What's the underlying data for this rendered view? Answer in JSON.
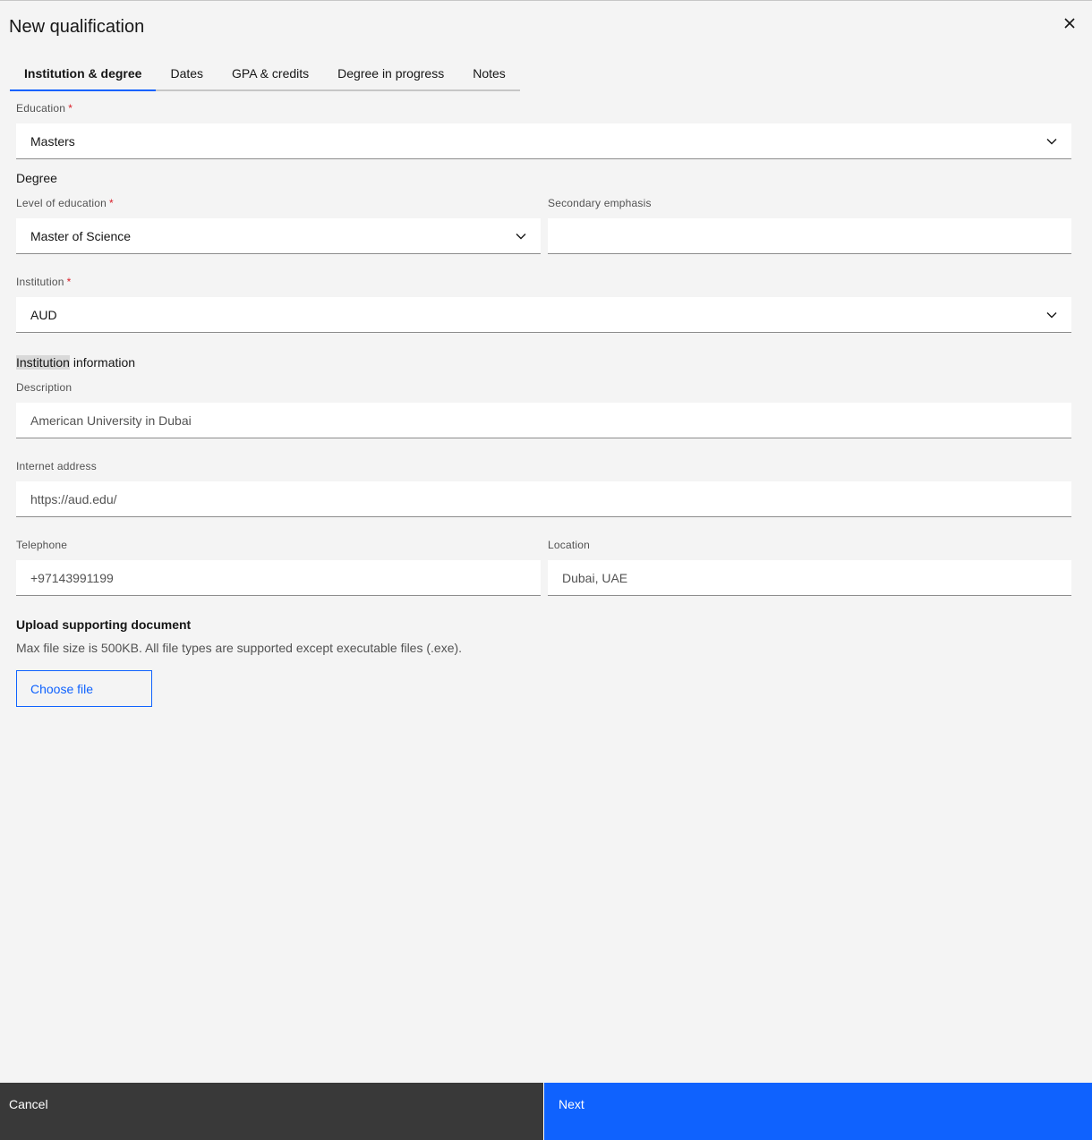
{
  "modal": {
    "title": "New qualification"
  },
  "tabs": [
    {
      "label": "Institution & degree",
      "active": true
    },
    {
      "label": "Dates"
    },
    {
      "label": "GPA & credits"
    },
    {
      "label": "Degree in progress"
    },
    {
      "label": "Notes"
    }
  ],
  "form": {
    "education": {
      "label": "Education",
      "required_mark": "*",
      "value": "Masters"
    },
    "degree_heading": "Degree",
    "level_of_education": {
      "label": "Level of education",
      "required_mark": "*",
      "value": "Master of Science"
    },
    "secondary_emphasis": {
      "label": "Secondary emphasis",
      "value": ""
    },
    "institution": {
      "label": "Institution",
      "required_mark": "*",
      "value": "AUD"
    },
    "institution_info_heading": {
      "highlighted": "Institution",
      "rest": " information"
    },
    "description": {
      "label": "Description",
      "value": "American University in Dubai"
    },
    "internet_address": {
      "label": "Internet address",
      "value": "https://aud.edu/"
    },
    "telephone": {
      "label": "Telephone",
      "value": "+97143991199"
    },
    "location": {
      "label": "Location",
      "value": "Dubai, UAE"
    }
  },
  "upload": {
    "title": "Upload supporting document",
    "description": "Max file size is 500KB. All file types are supported except executable files (.exe).",
    "button_label": "Choose file"
  },
  "footer": {
    "cancel_label": "Cancel",
    "next_label": "Next"
  },
  "colors": {
    "primary": "#0f62fe",
    "secondary": "#393939",
    "required": "#da1e28",
    "background": "#f4f4f4"
  }
}
